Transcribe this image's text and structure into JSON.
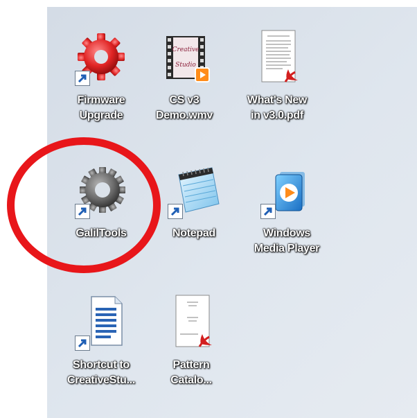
{
  "desktop_icons": [
    {
      "label_1": "Firmware",
      "label_2": "Upgrade",
      "icon": "red-gear-icon"
    },
    {
      "label_1": "CS v3",
      "label_2": "Demo.wmv",
      "icon": "video-file-icon"
    },
    {
      "label_1": "What's New",
      "label_2": "in v3.0.pdf",
      "icon": "pdf-document-icon"
    },
    {
      "label_1": "GalilTools",
      "label_2": "",
      "icon": "gray-gear-icon"
    },
    {
      "label_1": "Notepad",
      "label_2": "",
      "icon": "notepad-icon"
    },
    {
      "label_1": "Windows",
      "label_2": "Media Player",
      "icon": "media-player-icon"
    },
    {
      "label_1": "Shortcut to",
      "label_2": "CreativeStu...",
      "icon": "text-document-icon"
    },
    {
      "label_1": "Pattern",
      "label_2": "Catalo...",
      "icon": "pdf-document-icon"
    }
  ],
  "thumbnail_text": {
    "line_1": "Creative",
    "line_2": "Studio"
  },
  "colors": {
    "highlight_circle": "#e8161a",
    "desktop_bg": "#dbe2ea",
    "label_text": "#ffffff"
  }
}
